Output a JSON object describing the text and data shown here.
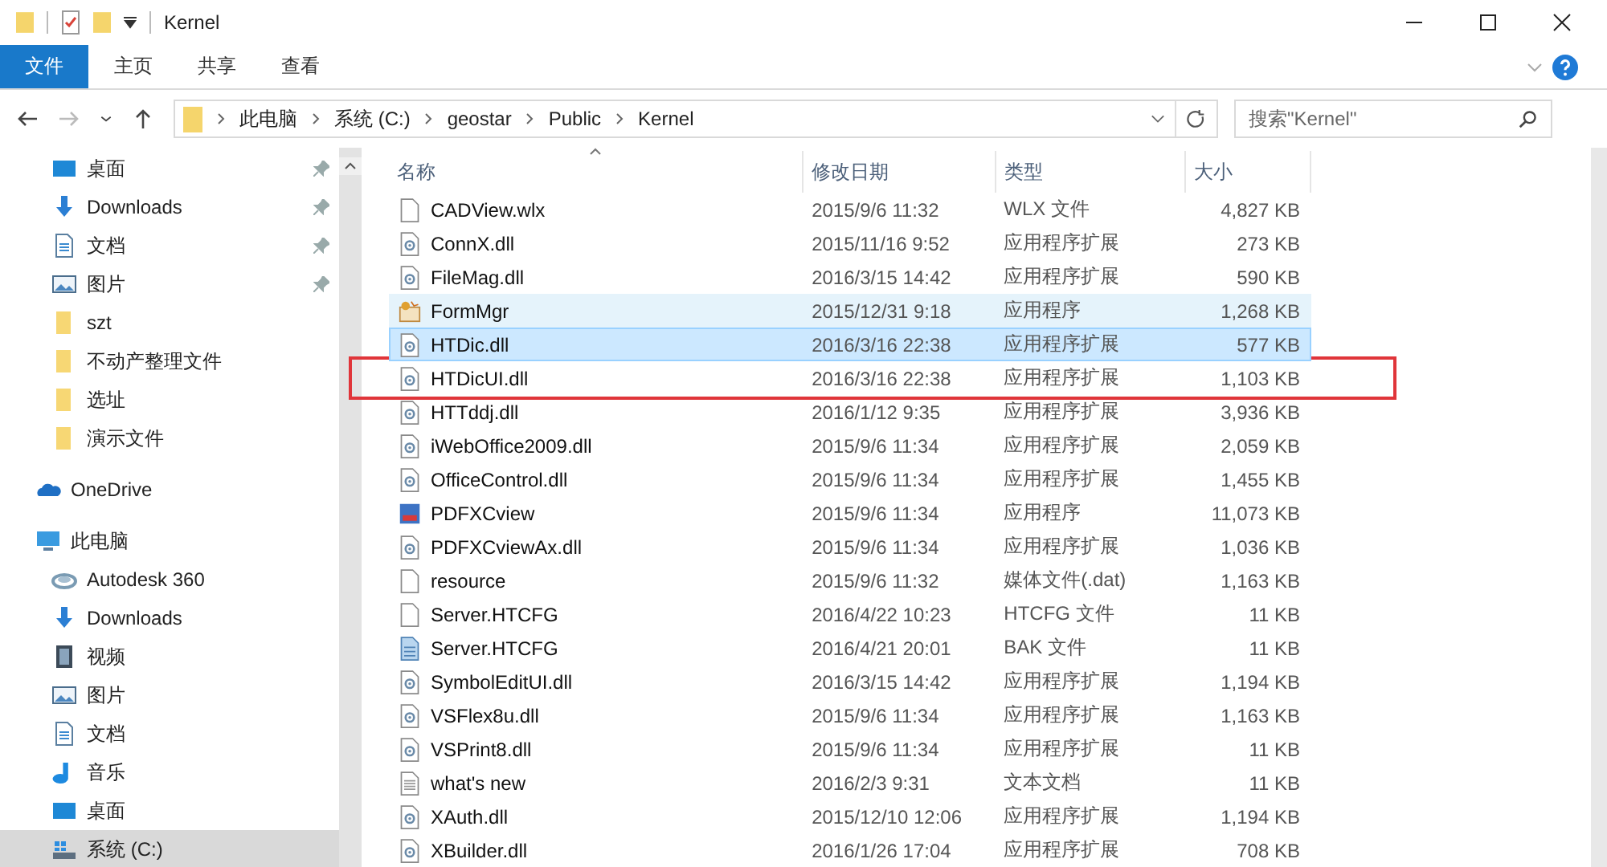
{
  "window": {
    "title": "Kernel"
  },
  "ribbon": {
    "tabs": [
      {
        "label": "文件",
        "selected": true
      },
      {
        "label": "主页",
        "selected": false
      },
      {
        "label": "共享",
        "selected": false
      },
      {
        "label": "查看",
        "selected": false
      }
    ]
  },
  "nav": [
    {
      "kind": "back",
      "disabled": false
    },
    {
      "kind": "forward",
      "disabled": true
    },
    {
      "kind": "recent",
      "disabled": false
    },
    {
      "kind": "up",
      "disabled": false
    }
  ],
  "address": {
    "path": [
      "此电脑",
      "系统 (C:)",
      "geostar",
      "Public",
      "Kernel"
    ]
  },
  "search": {
    "placeholder": "搜索\"Kernel\""
  },
  "sidebar": {
    "quick_access": [
      {
        "label": "桌面",
        "kind": "desktop",
        "pinned": true,
        "selected": false
      },
      {
        "label": "Downloads",
        "kind": "download",
        "pinned": true,
        "selected": false
      },
      {
        "label": "文档",
        "kind": "document",
        "pinned": true,
        "selected": false
      },
      {
        "label": "图片",
        "kind": "pictures",
        "pinned": true,
        "selected": false
      },
      {
        "label": "szt",
        "kind": "folder",
        "pinned": false,
        "selected": false
      },
      {
        "label": "不动产整理文件",
        "kind": "folder",
        "pinned": false,
        "selected": false
      },
      {
        "label": "选址",
        "kind": "folder",
        "pinned": false,
        "selected": false
      },
      {
        "label": "演示文件",
        "kind": "folder",
        "pinned": false,
        "selected": false
      }
    ],
    "items": [
      {
        "label": "OneDrive",
        "kind": "cloud",
        "selected": false
      },
      {
        "label": "此电脑",
        "kind": "pc",
        "selected": false,
        "children": [
          {
            "label": "Autodesk 360",
            "kind": "autodesk",
            "selected": false
          },
          {
            "label": "Downloads",
            "kind": "download",
            "selected": false
          },
          {
            "label": "视频",
            "kind": "video",
            "selected": false
          },
          {
            "label": "图片",
            "kind": "pictures",
            "selected": false
          },
          {
            "label": "文档",
            "kind": "document",
            "selected": false
          },
          {
            "label": "音乐",
            "kind": "music",
            "selected": false
          },
          {
            "label": "桌面",
            "kind": "desktop",
            "selected": false
          },
          {
            "label": "系统 (C:)",
            "kind": "drive",
            "selected": true
          }
        ]
      }
    ]
  },
  "table": {
    "columns": [
      {
        "label": "名称",
        "sorted": true
      },
      {
        "label": "修改日期",
        "sorted": false
      },
      {
        "label": "类型",
        "sorted": false
      },
      {
        "label": "大小",
        "sorted": false
      }
    ],
    "rows": [
      {
        "kind": "blank",
        "name": "CADView.wlx",
        "date": "2015/9/6 11:32",
        "type": "WLX 文件",
        "size": "4,827 KB",
        "selected": false,
        "hovered": false,
        "annotated": false
      },
      {
        "kind": "dll",
        "name": "ConnX.dll",
        "date": "2015/11/16 9:52",
        "type": "应用程序扩展",
        "size": "273 KB",
        "selected": false,
        "hovered": false,
        "annotated": false
      },
      {
        "kind": "dll",
        "name": "FileMag.dll",
        "date": "2016/3/15 14:42",
        "type": "应用程序扩展",
        "size": "590 KB",
        "selected": false,
        "hovered": false,
        "annotated": false
      },
      {
        "kind": "app",
        "name": "FormMgr",
        "date": "2015/12/31 9:18",
        "type": "应用程序",
        "size": "1,268 KB",
        "selected": false,
        "hovered": true,
        "annotated": false
      },
      {
        "kind": "dll",
        "name": "HTDic.dll",
        "date": "2016/3/16 22:38",
        "type": "应用程序扩展",
        "size": "577 KB",
        "selected": true,
        "hovered": false,
        "annotated": false
      },
      {
        "kind": "dll",
        "name": "HTDicUI.dll",
        "date": "2016/3/16 22:38",
        "type": "应用程序扩展",
        "size": "1,103 KB",
        "selected": false,
        "hovered": false,
        "annotated": true
      },
      {
        "kind": "dll",
        "name": "HTTddj.dll",
        "date": "2016/1/12 9:35",
        "type": "应用程序扩展",
        "size": "3,936 KB",
        "selected": false,
        "hovered": false,
        "annotated": false
      },
      {
        "kind": "dll",
        "name": "iWebOffice2009.dll",
        "date": "2015/9/6 11:34",
        "type": "应用程序扩展",
        "size": "2,059 KB",
        "selected": false,
        "hovered": false,
        "annotated": false
      },
      {
        "kind": "dll",
        "name": "OfficeControl.dll",
        "date": "2015/9/6 11:34",
        "type": "应用程序扩展",
        "size": "1,455 KB",
        "selected": false,
        "hovered": false,
        "annotated": false
      },
      {
        "kind": "pdf",
        "name": "PDFXCview",
        "date": "2015/9/6 11:34",
        "type": "应用程序",
        "size": "11,073 KB",
        "selected": false,
        "hovered": false,
        "annotated": false
      },
      {
        "kind": "dll",
        "name": "PDFXCviewAx.dll",
        "date": "2015/9/6 11:34",
        "type": "应用程序扩展",
        "size": "1,036 KB",
        "selected": false,
        "hovered": false,
        "annotated": false
      },
      {
        "kind": "blank",
        "name": "resource",
        "date": "2015/9/6 11:32",
        "type": "媒体文件(.dat)",
        "size": "1,163 KB",
        "selected": false,
        "hovered": false,
        "annotated": false
      },
      {
        "kind": "blank",
        "name": "Server.HTCFG",
        "date": "2016/4/22 10:23",
        "type": "HTCFG 文件",
        "size": "11 KB",
        "selected": false,
        "hovered": false,
        "annotated": false
      },
      {
        "kind": "bak",
        "name": "Server.HTCFG",
        "date": "2016/4/21 20:01",
        "type": "BAK 文件",
        "size": "11 KB",
        "selected": false,
        "hovered": false,
        "annotated": false
      },
      {
        "kind": "dll",
        "name": "SymbolEditUI.dll",
        "date": "2016/3/15 14:42",
        "type": "应用程序扩展",
        "size": "1,194 KB",
        "selected": false,
        "hovered": false,
        "annotated": false
      },
      {
        "kind": "dll",
        "name": "VSFlex8u.dll",
        "date": "2015/9/6 11:34",
        "type": "应用程序扩展",
        "size": "1,163 KB",
        "selected": false,
        "hovered": false,
        "annotated": false
      },
      {
        "kind": "dll",
        "name": "VSPrint8.dll",
        "date": "2015/9/6 11:34",
        "type": "应用程序扩展",
        "size": "11 KB",
        "selected": false,
        "hovered": false,
        "annotated": false
      },
      {
        "kind": "text",
        "name": "what's new",
        "date": "2016/2/3 9:31",
        "type": "文本文档",
        "size": "11 KB",
        "selected": false,
        "hovered": false,
        "annotated": false
      },
      {
        "kind": "dll",
        "name": "XAuth.dll",
        "date": "2015/12/10 12:06",
        "type": "应用程序扩展",
        "size": "1,194 KB",
        "selected": false,
        "hovered": false,
        "annotated": false
      },
      {
        "kind": "dll",
        "name": "XBuilder.dll",
        "date": "2016/1/26 17:04",
        "type": "应用程序扩展",
        "size": "708 KB",
        "selected": false,
        "hovered": false,
        "annotated": false
      }
    ]
  }
}
